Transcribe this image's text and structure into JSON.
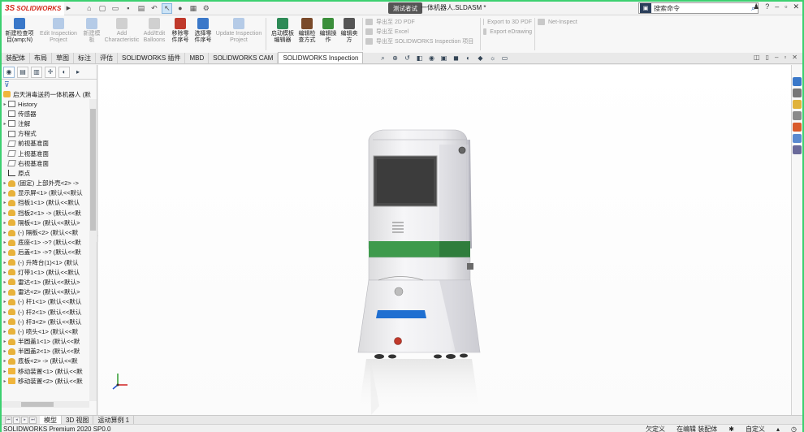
{
  "app": {
    "logo_ds": "3S",
    "logo_text": "SOLIDWORKS",
    "doc_title": "一体机器人.SLDASM *",
    "tooltip": "测试者试"
  },
  "search": {
    "placeholder": "搜索命令"
  },
  "ribbon": {
    "buttons": [
      {
        "label": "新建检查项\n目(amp;N)",
        "enabled": true,
        "color": "#3a78c9"
      },
      {
        "label": "Edit Inspection\nProject",
        "enabled": false,
        "color": "#3a78c9"
      },
      {
        "label": "新建模\n板",
        "enabled": false,
        "color": "#3a78c9"
      },
      {
        "label": "Add\nCharacteristic",
        "enabled": false,
        "color": "#888888"
      },
      {
        "label": "Add/Edit\nBalloons",
        "enabled": false,
        "color": "#888888"
      },
      {
        "label": "移除零\n件序号",
        "enabled": true,
        "color": "#c0392b"
      },
      {
        "label": "选择零\n件序号",
        "enabled": true,
        "color": "#3a78c9"
      },
      {
        "label": "Update Inspection\nProject",
        "enabled": false,
        "color": "#3a78c9"
      },
      {
        "label": "启动模板\n编辑器",
        "enabled": true,
        "color": "#2e8b57"
      },
      {
        "label": "编辑检\n查方式",
        "enabled": true,
        "color": "#7a4a2a"
      },
      {
        "label": "编辑操\n作",
        "enabled": true,
        "color": "#3b8f3b"
      },
      {
        "label": "编辑卖\n方",
        "enabled": true,
        "color": "#555555"
      }
    ],
    "export_group": [
      "导出至 2D PDF",
      "导出至 Excel",
      "导出至 SOLIDWORKS Inspection 项目"
    ],
    "export_group2": [
      "Export to 3D PDF",
      "Export eDrawing"
    ],
    "net_inspect": "Net-Inspect"
  },
  "tabs": [
    "装配体",
    "布局",
    "草图",
    "标注",
    "评估",
    "SOLIDWORKS 插件",
    "MBD",
    "SOLIDWORKS CAM",
    "SOLIDWORKS Inspection"
  ],
  "active_tab": "SOLIDWORKS Inspection",
  "tree": {
    "root": "启天消毒送药一体机器人  (默",
    "items": [
      {
        "label": "History",
        "icon": "folder",
        "exp": "▸"
      },
      {
        "label": "传感器",
        "icon": "folder",
        "exp": ""
      },
      {
        "label": "注解",
        "icon": "folder",
        "exp": "▸"
      },
      {
        "label": "方程式",
        "icon": "folder",
        "exp": ""
      },
      {
        "label": "前视基准面",
        "icon": "plane",
        "exp": ""
      },
      {
        "label": "上视基准面",
        "icon": "plane",
        "exp": ""
      },
      {
        "label": "右视基准面",
        "icon": "plane",
        "exp": ""
      },
      {
        "label": "原点",
        "icon": "origin",
        "exp": ""
      },
      {
        "label": "(固定) 上部外壳<2> ->",
        "icon": "part",
        "exp": "▸"
      },
      {
        "label": "显示屏<1> (默认<<默认",
        "icon": "part",
        "exp": "▸"
      },
      {
        "label": "挡板1<1> (默认<<默认",
        "icon": "part",
        "exp": "▸"
      },
      {
        "label": "挡板2<1> -> (默认<<默",
        "icon": "part",
        "exp": "▸"
      },
      {
        "label": "隔板<1> (默认<<默认>",
        "icon": "part",
        "exp": "▸"
      },
      {
        "label": "(-) 隔板<2> (默认<<默",
        "icon": "part",
        "exp": "▸"
      },
      {
        "label": "底座<1> ->? (默认<<默",
        "icon": "part",
        "exp": "▸"
      },
      {
        "label": "后盖<1> ->? (默认<<默",
        "icon": "part",
        "exp": "▸"
      },
      {
        "label": "(-) 升降台(1)<1> (默认",
        "icon": "part",
        "exp": "▸"
      },
      {
        "label": "灯带1<1> (默认<<默认",
        "icon": "part",
        "exp": "▸"
      },
      {
        "label": "雷达<1> (默认<<默认>",
        "icon": "part",
        "exp": "▸"
      },
      {
        "label": "雷达<2> (默认<<默认>",
        "icon": "part",
        "exp": "▸"
      },
      {
        "label": "(-) 杆1<1> (默认<<默认",
        "icon": "part",
        "exp": "▸"
      },
      {
        "label": "(-) 杆2<1> (默认<<默认",
        "icon": "part",
        "exp": "▸"
      },
      {
        "label": "(-) 杆3<2> (默认<<默认",
        "icon": "part",
        "exp": "▸"
      },
      {
        "label": "(-) 喷头<1> (默认<<默",
        "icon": "part",
        "exp": "▸"
      },
      {
        "label": "半圆盖1<1> (默认<<默",
        "icon": "part",
        "exp": "▸"
      },
      {
        "label": "半圆盖2<1> (默认<<默",
        "icon": "part",
        "exp": "▸"
      },
      {
        "label": "底板<2> -> (默认<<默",
        "icon": "part",
        "exp": "▸"
      },
      {
        "label": "移动装置<1> (默认<<默",
        "icon": "asm",
        "exp": "▸"
      },
      {
        "label": "移动装置<2> (默认<<默",
        "icon": "asm",
        "exp": "▸"
      }
    ]
  },
  "bottom_tabs": [
    "模型",
    "3D 视图",
    "运动算例 1"
  ],
  "active_bottom_tab": "模型",
  "status": {
    "version": "SOLIDWORKS Premium 2020 SP0.0",
    "underdefined": "欠定义",
    "editing": "在编辑 装配体",
    "custom": "自定义"
  },
  "colors": {
    "brand_red": "#d52b1e",
    "robot_green": "#3e9a4c",
    "robot_blue": "#1f6fd1",
    "window_border": "#3cd070"
  }
}
